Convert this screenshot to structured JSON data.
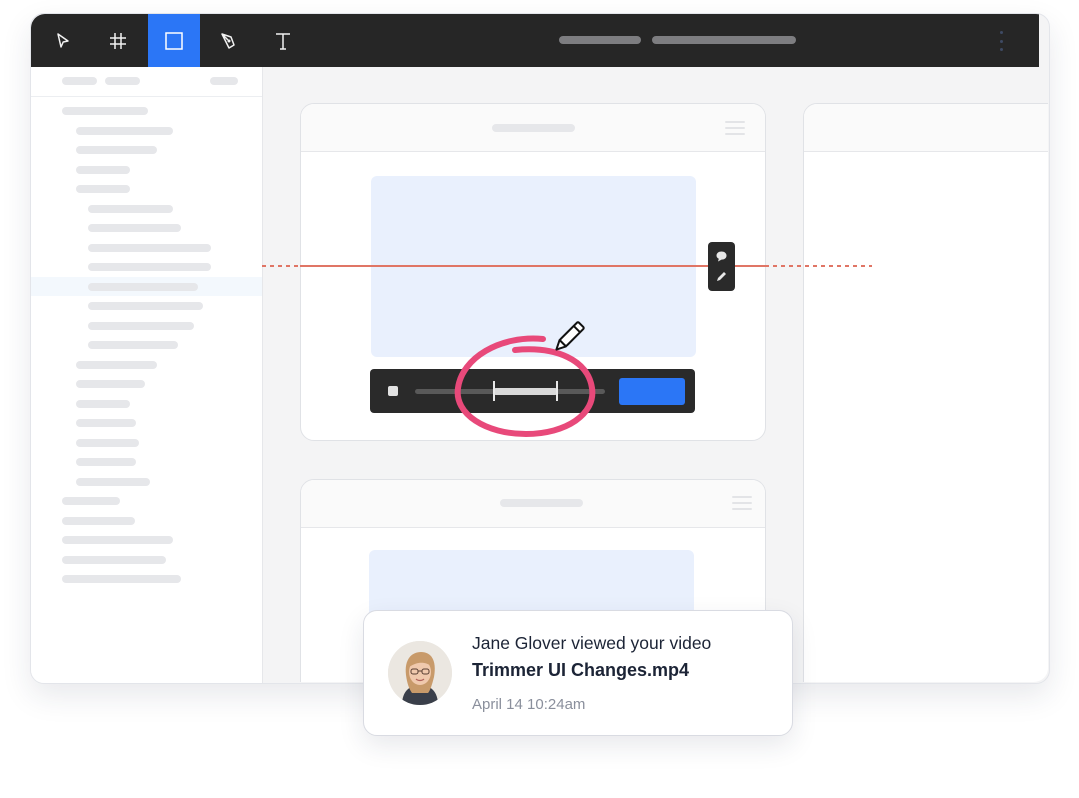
{
  "toolbar": {
    "tools": [
      {
        "name": "pointer-icon",
        "active": false
      },
      {
        "name": "frame-icon",
        "active": false
      },
      {
        "name": "rectangle-icon",
        "active": true
      },
      {
        "name": "pen-icon",
        "active": false
      },
      {
        "name": "text-icon",
        "active": false
      }
    ],
    "menu_icon": "kebab-icon"
  },
  "canvas": {
    "player_icons": [
      "stop-icon",
      "play-action-button"
    ],
    "side_tools": [
      "comment-icon",
      "pencil-icon"
    ],
    "annotation_icon": "pencil-icon"
  },
  "notification": {
    "message": "Jane Glover viewed your video",
    "file": "Trimmer UI Changes.mp4",
    "time": "April 14 10:24am"
  },
  "colors": {
    "accent": "#2b76f6",
    "toolbar_bg": "#262626",
    "annotation": "#e8497a",
    "guide": "#e07565"
  }
}
